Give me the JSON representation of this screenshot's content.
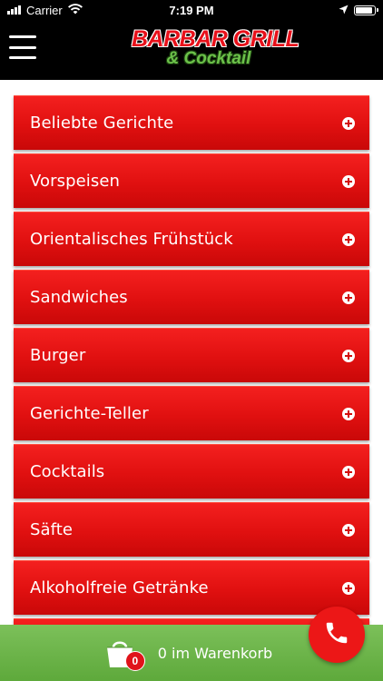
{
  "status_bar": {
    "carrier": "Carrier",
    "time": "7:19 PM"
  },
  "header": {
    "logo_main": "BARBAR GRILL",
    "logo_sub": "& Cocktail"
  },
  "categories": [
    {
      "label": "Beliebte Gerichte"
    },
    {
      "label": "Vorspeisen"
    },
    {
      "label": "Orientalisches Frühstück"
    },
    {
      "label": "Sandwiches"
    },
    {
      "label": "Burger"
    },
    {
      "label": "Gerichte-Teller"
    },
    {
      "label": "Cocktails"
    },
    {
      "label": "Säfte"
    },
    {
      "label": "Alkoholfreie Getränke"
    },
    {
      "label": ""
    }
  ],
  "cart": {
    "count": "0",
    "label": "0 im Warenkorb"
  },
  "colors": {
    "accent_red": "#e01010",
    "cart_green": "#6ab547",
    "header_black": "#000000"
  },
  "icons": {
    "menu": "hamburger-icon",
    "expand": "plus-circle-icon",
    "cart": "shopping-bag-icon",
    "call": "phone-icon"
  }
}
